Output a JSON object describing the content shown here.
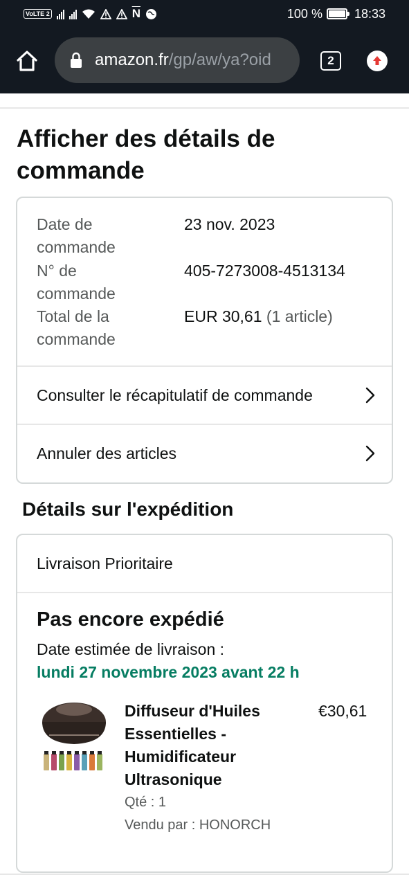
{
  "status_bar": {
    "left_chip_1": "VoLTE",
    "left_chip_2": "2",
    "notif_letter": "N",
    "battery_text": "100 %",
    "time": "18:33"
  },
  "browser": {
    "url_domain": "amazon.fr",
    "url_path": "/gp/aw/ya?oid",
    "tab_count": "2",
    "icons": {
      "home": "home-icon",
      "lock": "lock-icon",
      "update": "update-arrow-icon"
    }
  },
  "page": {
    "title": "Afficher des détails de commande"
  },
  "order_summary": {
    "rows": [
      {
        "label": "Date de commande",
        "value": "23 nov. 2023"
      },
      {
        "label": "N° de commande",
        "value": "405-7273008-4513134"
      },
      {
        "label": "Total de la commande",
        "value": "EUR 30,61",
        "value_note": "(1 article)"
      }
    ],
    "links": [
      {
        "label": "Consulter le récapitulatif de commande"
      },
      {
        "label": "Annuler des articles"
      }
    ]
  },
  "shipment": {
    "section_title": "Détails sur l'expédition",
    "method": "Livraison Prioritaire",
    "status": "Pas encore expédié",
    "estimated_label": "Date estimée de livraison :",
    "estimated_date": "lundi 27 novembre 2023 avant 22 h",
    "item": {
      "title": "Diffuseur d'Huiles Essentielles - Humidificateur Ultrasonique",
      "price": "€30,61",
      "qty": "Qté : 1",
      "seller": "Vendu par : HONORCH"
    }
  },
  "colors": {
    "header_bg": "#131921",
    "url_box_bg": "#3c4043",
    "delivery_green": "#067d62",
    "card_border": "#d5d9d9"
  }
}
